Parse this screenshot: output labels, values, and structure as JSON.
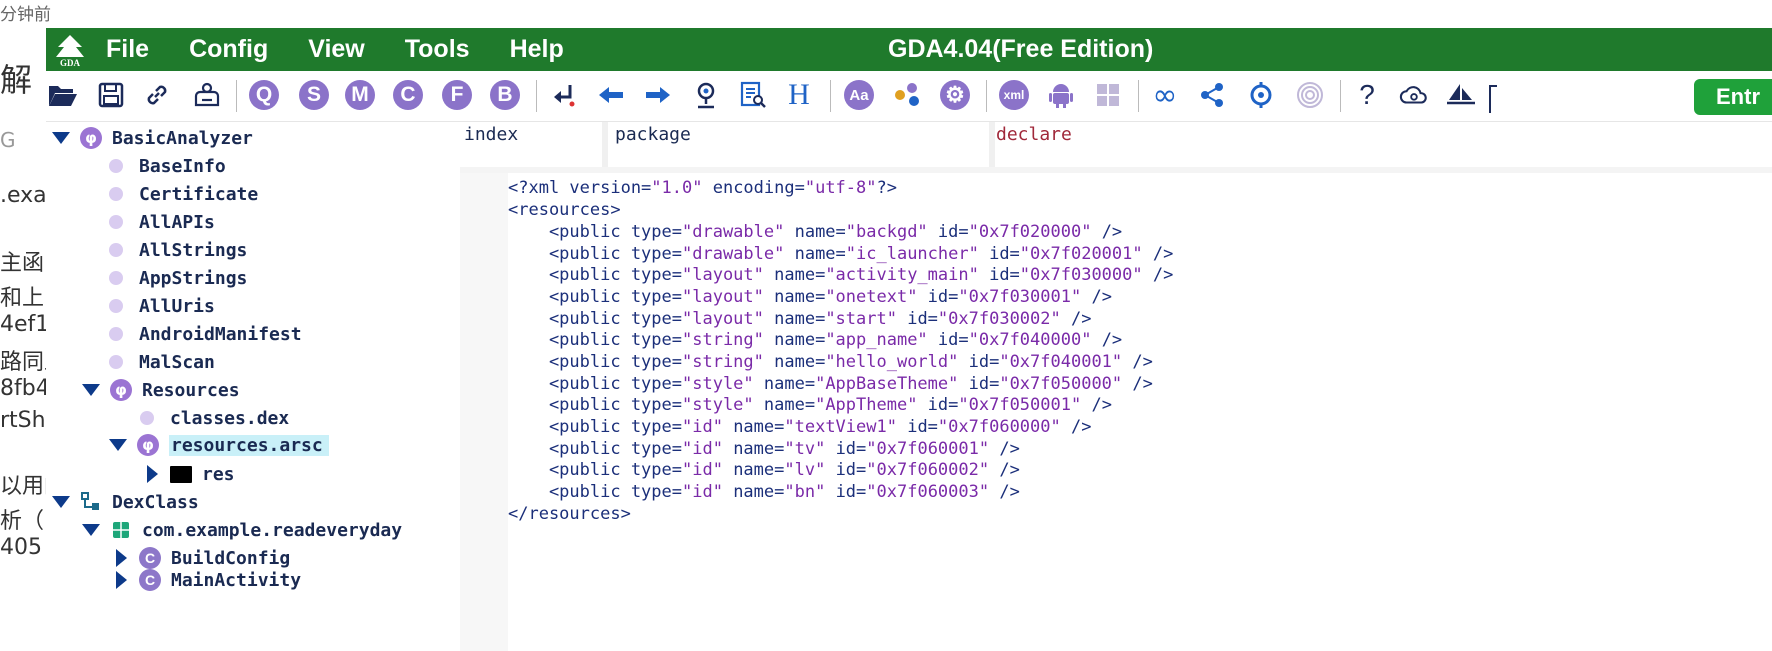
{
  "background": {
    "top_text": "分钟前",
    "fragments": [
      "解",
      "G",
      ".exa",
      "主函",
      "和上",
      "4ef1",
      "路同上",
      "8fb4",
      "rtSh",
      "以用的",
      "析（",
      "405"
    ]
  },
  "app": {
    "menu": [
      "File",
      "Config",
      "View",
      "Tools",
      "Help"
    ],
    "title": "GDA4.04(Free Edition)",
    "entry_button": "Entr",
    "toolbar_letters": [
      "Q",
      "S",
      "M",
      "C",
      "F",
      "B"
    ],
    "colors": {
      "titlebar": "#1f7a2c",
      "accent_purple": "#8b73c9",
      "entry_green": "#1fa13a"
    }
  },
  "tree": [
    {
      "label": "BasicAnalyzer",
      "kind": "root"
    },
    {
      "label": "BaseInfo",
      "kind": "leaf"
    },
    {
      "label": "Certificate",
      "kind": "leaf"
    },
    {
      "label": "AllAPIs",
      "kind": "leaf"
    },
    {
      "label": "AllStrings",
      "kind": "leaf"
    },
    {
      "label": "AppStrings",
      "kind": "leaf"
    },
    {
      "label": "AllUris",
      "kind": "leaf"
    },
    {
      "label": "AndroidManifest",
      "kind": "leaf"
    },
    {
      "label": "MalScan",
      "kind": "leaf"
    },
    {
      "label": "Resources",
      "kind": "folder"
    },
    {
      "label": "classes.dex",
      "kind": "leaf"
    },
    {
      "label": "resources.arsc",
      "kind": "selected"
    },
    {
      "label": "res",
      "kind": "dir"
    },
    {
      "label": "DexClass",
      "kind": "root"
    },
    {
      "label": "com.example.readeveryday",
      "kind": "package"
    },
    {
      "label": "BuildConfig",
      "kind": "class"
    },
    {
      "label": "MainActivity",
      "kind": "class"
    }
  ],
  "table": {
    "columns": [
      "index",
      "package",
      "declare"
    ]
  },
  "code": {
    "lines": [
      "<?xml version=\"1.0\" encoding=\"utf-8\"?>",
      "<resources>",
      "    <public type=\"drawable\" name=\"backgd\" id=\"0x7f020000\" />",
      "    <public type=\"drawable\" name=\"ic_launcher\" id=\"0x7f020001\" />",
      "    <public type=\"layout\" name=\"activity_main\" id=\"0x7f030000\" />",
      "    <public type=\"layout\" name=\"onetext\" id=\"0x7f030001\" />",
      "    <public type=\"layout\" name=\"start\" id=\"0x7f030002\" />",
      "    <public type=\"string\" name=\"app_name\" id=\"0x7f040000\" />",
      "    <public type=\"string\" name=\"hello_world\" id=\"0x7f040001\" />",
      "    <public type=\"style\" name=\"AppBaseTheme\" id=\"0x7f050000\" />",
      "    <public type=\"style\" name=\"AppTheme\" id=\"0x7f050001\" />",
      "    <public type=\"id\" name=\"textView1\" id=\"0x7f060000\" />",
      "    <public type=\"id\" name=\"tv\" id=\"0x7f060001\" />",
      "    <public type=\"id\" name=\"lv\" id=\"0x7f060002\" />",
      "    <public type=\"id\" name=\"bn\" id=\"0x7f060003\" />",
      "</resources>"
    ]
  }
}
